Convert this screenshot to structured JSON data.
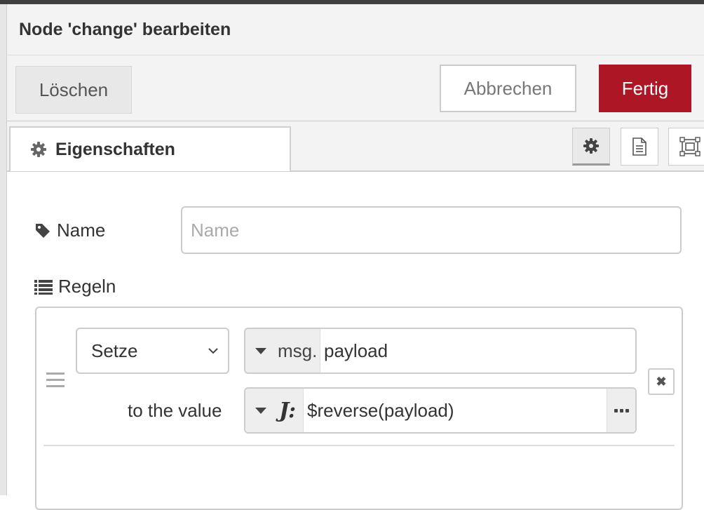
{
  "dialog": {
    "title": "Node 'change' bearbeiten"
  },
  "toolbar": {
    "delete_label": "Löschen",
    "cancel_label": "Abbrechen",
    "done_label": "Fertig"
  },
  "tabs": {
    "properties_label": "Eigenschaften"
  },
  "form": {
    "name_label": "Name",
    "name_placeholder": "Name",
    "name_value": "",
    "rules_label": "Regeln"
  },
  "rule": {
    "action": "Setze",
    "property_type": "msg.",
    "property_value": "payload",
    "to_label": "to the value",
    "value_type_icon": "J:",
    "value": "$reverse(payload)",
    "remove_glyph": "✖"
  },
  "colors": {
    "primary": "#ad1625",
    "header_bg": "#f3f3f3"
  }
}
